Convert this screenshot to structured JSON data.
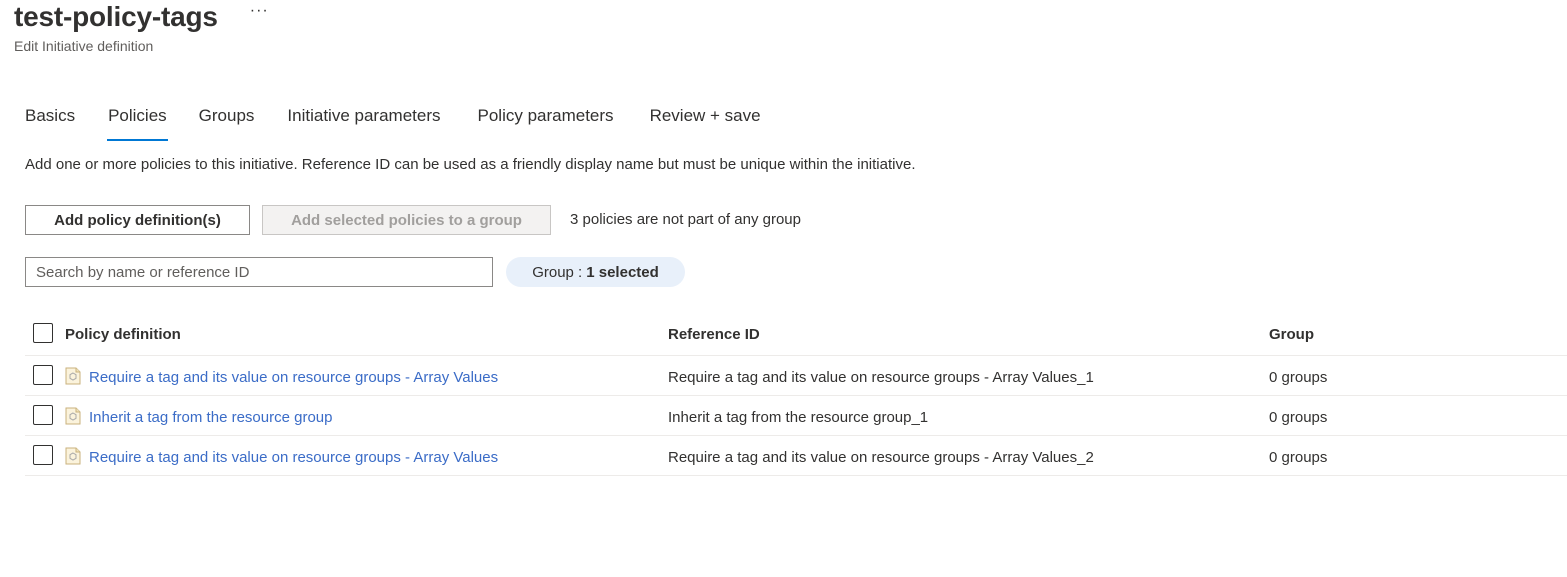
{
  "header": {
    "title": "test-policy-tags",
    "more_label": "···",
    "subtitle": "Edit Initiative definition"
  },
  "tabs": [
    {
      "label": "Basics",
      "active": false
    },
    {
      "label": "Policies",
      "active": true
    },
    {
      "label": "Groups",
      "active": false
    },
    {
      "label": "Initiative parameters",
      "active": false
    },
    {
      "label": "Policy parameters",
      "active": false
    },
    {
      "label": "Review + save",
      "active": false
    }
  ],
  "description": "Add one or more policies to this initiative. Reference ID can be used as a friendly display name but must be unique within the initiative.",
  "toolbar": {
    "add_policy_label": "Add policy definition(s)",
    "add_to_group_label": "Add selected policies to a group",
    "ungrouped_note": "3 policies are not part of any group"
  },
  "search": {
    "placeholder": "Search by name or reference ID",
    "value": ""
  },
  "filter": {
    "label": "Group : ",
    "value": "1 selected"
  },
  "table": {
    "columns": {
      "policy": "Policy definition",
      "reference": "Reference ID",
      "group": "Group"
    },
    "rows": [
      {
        "policy": "Require a tag and its value on resource groups - Array Values",
        "reference": "Require a tag and its value on resource groups - Array Values_1",
        "group": "0 groups",
        "icon": "policy-definition-icon"
      },
      {
        "policy": "Inherit a tag from the resource group",
        "reference": "Inherit a tag from the resource group_1",
        "group": "0 groups",
        "icon": "policy-definition-icon"
      },
      {
        "policy": "Require a tag and its value on resource groups - Array Values",
        "reference": "Require a tag and its value on resource groups - Array Values_2",
        "group": "0 groups",
        "icon": "policy-definition-icon"
      }
    ]
  },
  "colors": {
    "accent": "#0078d4",
    "link": "#3b6cc7",
    "pill_background": "#e8f0fa",
    "disabled_background": "#f3f2f1",
    "disabled_text": "#a19f9d"
  }
}
